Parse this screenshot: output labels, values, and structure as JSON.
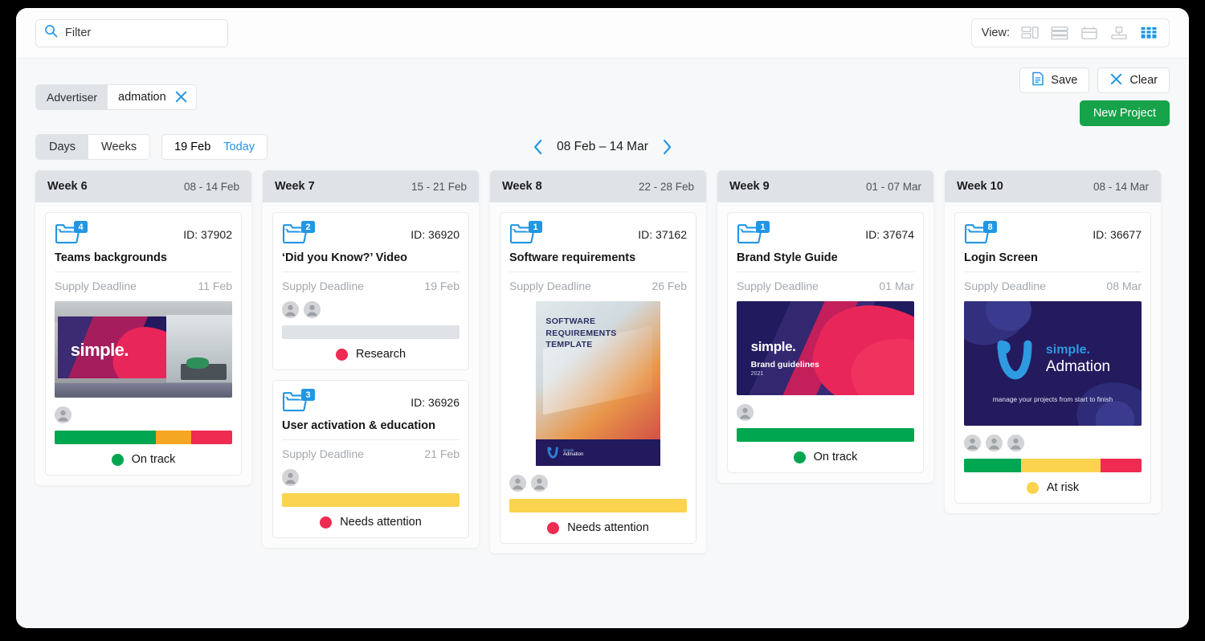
{
  "topbar": {
    "search_placeholder": "Filter",
    "view_label": "View:",
    "view_icons": [
      "split-view-icon",
      "list-view-icon",
      "calendar-view-icon",
      "gantt-view-icon",
      "kanban-view-icon"
    ],
    "active_view": "kanban-view-icon"
  },
  "filters": {
    "chip_key": "Advertiser",
    "chip_value": "admation",
    "save_label": "Save",
    "clear_label": "Clear",
    "new_project_label": "New Project",
    "days_label": "Days",
    "weeks_label": "Weeks",
    "active_segment": "Weeks",
    "current_date": "19 Feb",
    "today_label": "Today",
    "range_label": "08 Feb – 14 Mar"
  },
  "colors": {
    "accent_blue": "#2196e3",
    "green": "#00a650",
    "orange": "#f5a623",
    "red": "#ef2b52",
    "yellow": "#fbd34e",
    "grey_bar": "#dfe3e8",
    "new_project_green": "#16a34a"
  },
  "labels": {
    "supply_deadline": "Supply Deadline",
    "id_prefix": "ID: "
  },
  "columns": [
    {
      "week": "Week 6",
      "range": "08 - 14 Feb",
      "cards": [
        {
          "count": "4",
          "id": "ID: 37902",
          "title": "Teams backgrounds",
          "deadline_label": "Supply Deadline",
          "deadline": "11 Feb",
          "thumbnail": "office-simple-wall",
          "thumbnail_text": "simple.",
          "avatars": 1,
          "progress": [
            {
              "color": "#00a650",
              "pct": 57
            },
            {
              "color": "#f5a623",
              "pct": 20
            },
            {
              "color": "#ef2b52",
              "pct": 23
            }
          ],
          "status": "On track",
          "status_color": "#00a650"
        }
      ]
    },
    {
      "week": "Week 7",
      "range": "15 - 21 Feb",
      "cards": [
        {
          "count": "2",
          "id": "ID: 36920",
          "title": "‘Did you Know?’ Video",
          "deadline_label": "Supply Deadline",
          "deadline": "19 Feb",
          "thumbnail": null,
          "avatars": 2,
          "progress": [
            {
              "color": "#dfe3e8",
              "pct": 100
            }
          ],
          "status": "Research",
          "status_color": "#ef2b52"
        },
        {
          "count": "3",
          "id": "ID: 36926",
          "title": "User activation & education",
          "deadline_label": "Supply Deadline",
          "deadline": "21 Feb",
          "thumbnail": null,
          "avatars": 1,
          "progress": [
            {
              "color": "#fbd34e",
              "pct": 100
            }
          ],
          "status": "Needs attention",
          "status_color": "#ef2b52"
        }
      ]
    },
    {
      "week": "Week 8",
      "range": "22 - 28 Feb",
      "cards": [
        {
          "count": "1",
          "id": "ID: 37162",
          "title": "Software requirements",
          "deadline_label": "Supply Deadline",
          "deadline": "26 Feb",
          "thumbnail": "software-requirements-doc",
          "thumbnail_text": "SOFTWARE REQUIREMENTS TEMPLATE",
          "thumbnail_footer": "Admation",
          "avatars": 2,
          "progress": [
            {
              "color": "#fbd34e",
              "pct": 100
            }
          ],
          "status": "Needs attention",
          "status_color": "#ef2b52"
        }
      ]
    },
    {
      "week": "Week 9",
      "range": "01 - 07 Mar",
      "cards": [
        {
          "count": "1",
          "id": "ID: 37674",
          "title": "Brand Style Guide",
          "deadline_label": "Supply Deadline",
          "deadline": "01 Mar",
          "thumbnail": "brand-guidelines-cover",
          "thumbnail_text": "simple.",
          "thumbnail_sub": "Brand guidelines",
          "thumbnail_year": "2021",
          "avatars": 1,
          "progress": [
            {
              "color": "#00a650",
              "pct": 100
            }
          ],
          "status": "On track",
          "status_color": "#00a650"
        }
      ]
    },
    {
      "week": "Week 10",
      "range": "08 - 14 Mar",
      "cards": [
        {
          "count": "8",
          "id": "ID: 36677",
          "title": "Login Screen",
          "deadline_label": "Supply Deadline",
          "deadline": "08 Mar",
          "thumbnail": "admation-login-splash",
          "thumbnail_text": "simple.",
          "thumbnail_sub": "Admation",
          "thumbnail_tagline": "manage your projects from start to finish",
          "avatars": 3,
          "progress": [
            {
              "color": "#00a650",
              "pct": 32
            },
            {
              "color": "#fbd34e",
              "pct": 45
            },
            {
              "color": "#ef2b52",
              "pct": 23
            }
          ],
          "status": "At risk",
          "status_color": "#fbd34e"
        }
      ]
    }
  ]
}
